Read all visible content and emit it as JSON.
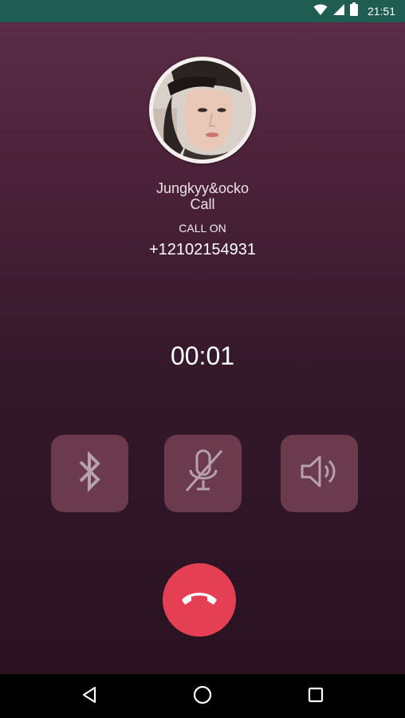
{
  "status_bar": {
    "time": "21:51",
    "icons": [
      "wifi-icon",
      "cell-signal-icon",
      "battery-icon"
    ]
  },
  "caller": {
    "name": "Jungkyy&ocko",
    "label": "Call",
    "status": "CALL ON",
    "number": "+12102154931",
    "avatar_icon": "contact-photo"
  },
  "call": {
    "duration": "00:01"
  },
  "controls": [
    {
      "name": "bluetooth",
      "icon": "bluetooth-icon"
    },
    {
      "name": "mute",
      "icon": "mic-off-icon"
    },
    {
      "name": "speaker",
      "icon": "speaker-icon"
    }
  ],
  "end_call": {
    "icon": "phone-hangup-icon"
  },
  "nav": {
    "icons": [
      "back-icon",
      "home-icon",
      "recents-icon"
    ]
  },
  "colors": {
    "status_bar": "#1f5c52",
    "background_top": "#5a2c46",
    "background_bottom": "#2a1221",
    "control_button": "#6b3a4c",
    "end_call": "#e53f53",
    "nav_bar": "#000000"
  }
}
